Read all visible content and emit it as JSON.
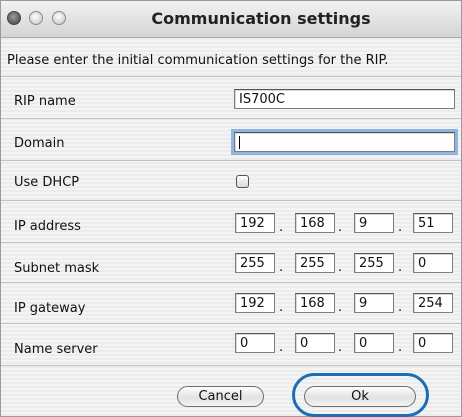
{
  "window": {
    "title": "Communication settings",
    "intro": "Please enter the initial communication settings for the RIP."
  },
  "fields": {
    "rip_name": {
      "label": "RIP name",
      "value": "IS700C"
    },
    "domain": {
      "label": "Domain",
      "value": ""
    },
    "use_dhcp": {
      "label": "Use DHCP",
      "checked": false
    },
    "ip_address": {
      "label": "IP address",
      "octets": [
        "192",
        "168",
        "9",
        "51"
      ]
    },
    "subnet_mask": {
      "label": "Subnet mask",
      "octets": [
        "255",
        "255",
        "255",
        "0"
      ]
    },
    "ip_gateway": {
      "label": "IP gateway",
      "octets": [
        "192",
        "168",
        "9",
        "254"
      ]
    },
    "name_server": {
      "label": "Name server",
      "octets": [
        "0",
        "0",
        "0",
        "0"
      ]
    }
  },
  "buttons": {
    "cancel": "Cancel",
    "ok": "Ok"
  },
  "separator": ".",
  "highlight_color": "#1b6db4"
}
